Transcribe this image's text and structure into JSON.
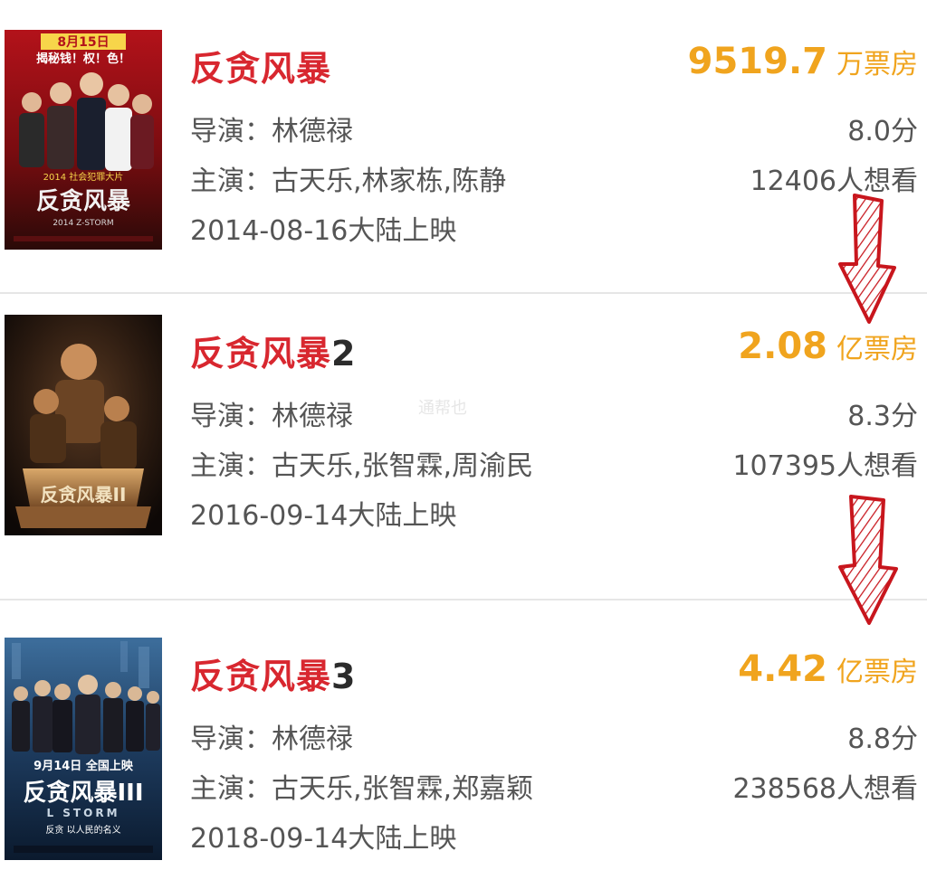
{
  "movies": [
    {
      "title": "反贪风暴",
      "sequel_number": "",
      "box_office_amount": "9519.7",
      "box_office_unit": "万票房",
      "director_label": "导演：",
      "director": "林德禄",
      "cast_label": "主演：",
      "cast": "古天乐,林家栋,陈静",
      "release": "2014-08-16大陆上映",
      "score": "8.0分",
      "want_to_see": "12406人想看",
      "poster": {
        "top_text": "8月15日",
        "tagline": "揭秘钱！权！色！",
        "sub_text": "2014 社会犯罪大片",
        "logo_text": "反贪风暴",
        "small_text": "2014 Z-STORM"
      }
    },
    {
      "title": "反贪风暴",
      "sequel_number": "2",
      "box_office_amount": "2.08",
      "box_office_unit": "亿票房",
      "director_label": "导演：",
      "director": "林德禄",
      "cast_label": "主演：",
      "cast": "古天乐,张智霖,周渝民",
      "release": "2016-09-14大陆上映",
      "score": "8.3分",
      "want_to_see": "107395人想看",
      "poster": {
        "logo_text": "反贪风暴II"
      }
    },
    {
      "title": "反贪风暴",
      "sequel_number": "3",
      "box_office_amount": "4.42",
      "box_office_unit": "亿票房",
      "director_label": "导演：",
      "director": "林德禄",
      "cast_label": "主演：",
      "cast": "古天乐,张智霖,郑嘉颖",
      "release": "2018-09-14大陆上映",
      "score": "8.8分",
      "want_to_see": "238568人想看",
      "poster": {
        "date_text": "9月14日 全国上映",
        "logo_text": "反贪风暴III",
        "small_text": "L STORM",
        "tagline": "反贪 以人民的名义"
      }
    }
  ],
  "watermark": "通帮也",
  "colors": {
    "title_red": "#d8272f",
    "box_office_orange": "#f0a41e",
    "arrow_red": "#c8161d",
    "text_gray": "#555555",
    "divider": "#e6e6e6"
  },
  "icons": [
    "down-arrow-icon"
  ]
}
